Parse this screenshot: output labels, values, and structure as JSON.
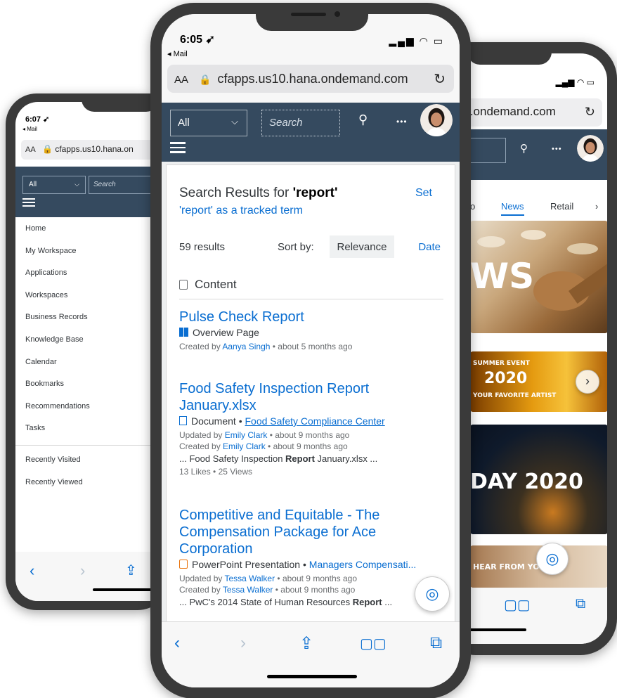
{
  "left_phone": {
    "time": "6:07",
    "back_app": "◂ Mail",
    "text_size": "AA",
    "url": "cfapps.us10.hana.on",
    "filter": "All",
    "search_placeholder": "Search",
    "menu": [
      "Home",
      "My Workspace",
      "Applications",
      "Workspaces",
      "Business Records",
      "Knowledge Base",
      "Calendar",
      "Bookmarks",
      "Recommendations",
      "Tasks"
    ],
    "menu_secondary": [
      "Recently Visited",
      "Recently Viewed"
    ]
  },
  "center_phone": {
    "time": "6:05",
    "back_app": "◂ Mail",
    "text_size": "AA",
    "url": "cfapps.us10.hana.ondemand.com",
    "filter": "All",
    "search_placeholder": "Search",
    "heading_prefix": "Search Results for ",
    "heading_term": "'report'",
    "set_label": "Set",
    "tracked_label": "'report' as a tracked term",
    "result_count": "59 results",
    "sort_label": "Sort by:",
    "sort_relevance": "Relevance",
    "sort_date": "Date",
    "section": "Content",
    "results": [
      {
        "title": "Pulse Check Report",
        "type": "Overview Page",
        "line1_prefix": "Created by ",
        "line1_person": "Aanya Singh",
        "line1_suffix": " • about 5 months ago"
      },
      {
        "title": "Food Safety Inspection Report January.xlsx",
        "type": "Document",
        "location": "Food Safety Compliance Center",
        "line1_prefix": "Updated by ",
        "line1_person": "Emily Clark",
        "line1_suffix": " • about 9 months ago",
        "line2_prefix": "Created by ",
        "line2_person": "Emily Clark",
        "line2_suffix": " • about 9 months ago",
        "snippet_pre": "... Food Safety Inspection ",
        "snippet_bold": "Report",
        "snippet_post": " January.xlsx ...",
        "stats": "13 Likes • 25 Views"
      },
      {
        "title": "Competitive and Equitable - The Compensation Package for Ace Corporation",
        "type": "PowerPoint Presentation",
        "location": "Managers Compensati...",
        "line1_prefix": "Updated by ",
        "line1_person": "Tessa Walker",
        "line1_suffix": " • about 9 months ago",
        "line2_prefix": "Created by ",
        "line2_person": "Tessa Walker",
        "line2_suffix": " • about 9 months ago",
        "snippet_pre": "... PwC's 2014 State of Human Resources ",
        "snippet_bold": "Report",
        "snippet_post": " ..."
      }
    ]
  },
  "right_phone": {
    "url": "hana.ondemand.com",
    "tabs": [
      "News",
      "Retail"
    ],
    "tile1_text": "WS",
    "tile2_text_a": "SUMMER EVENT",
    "tile2_text_b": "2020",
    "tile2_text_c": "YOUR FAVORITE ARTIST",
    "tile3_text": "DAY 2020",
    "tile4_text": "HEAR FROM YOU"
  },
  "colors": {
    "shell": "#354a5f",
    "link": "#0a6ed1",
    "device": "#3a3a3a"
  }
}
